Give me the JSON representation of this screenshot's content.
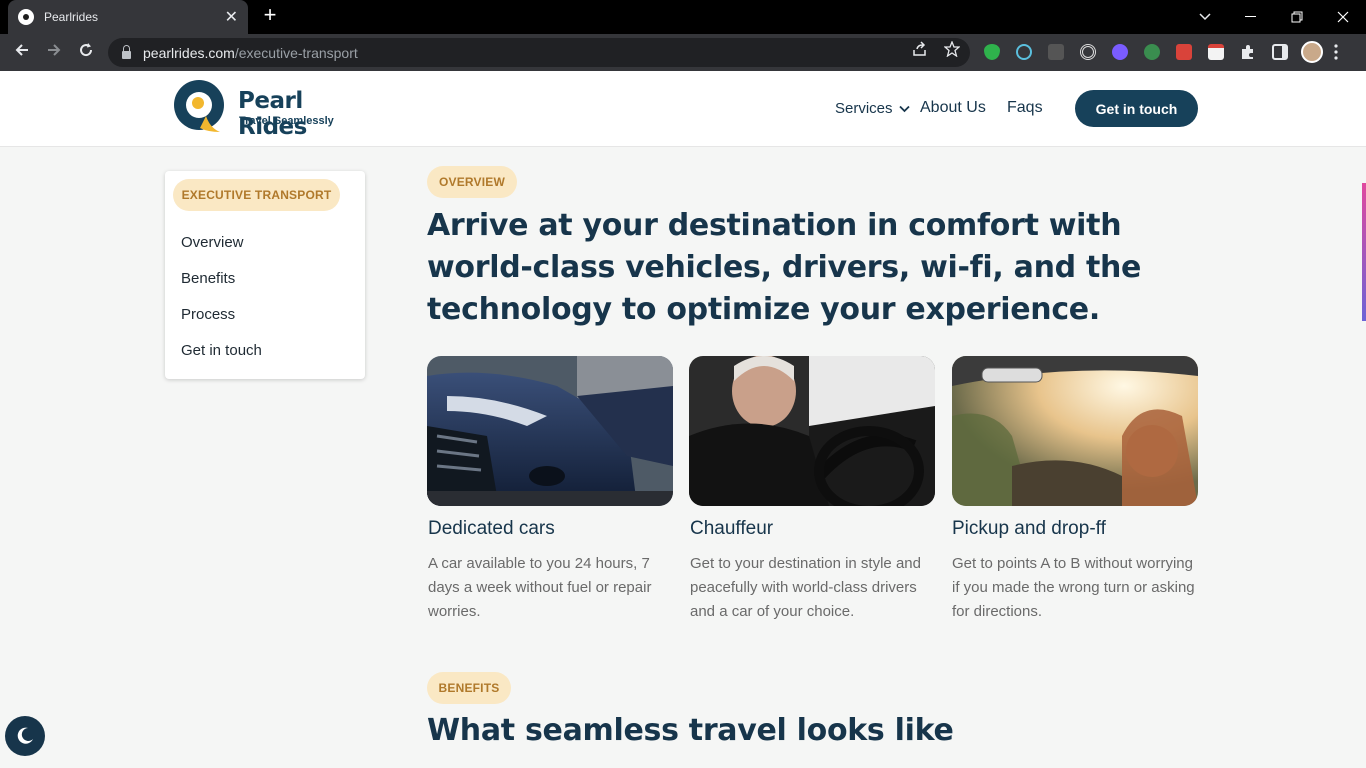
{
  "browser": {
    "tab_title": "Pearlrides",
    "url_host": "pearlrides.com",
    "url_path": "/executive-transport",
    "new_tab": "+",
    "tab_close": "✕"
  },
  "header": {
    "logo_name": "Pearl Rides",
    "logo_tagline": "Travel Seamlessly",
    "nav": {
      "services": "Services",
      "about": "About Us",
      "faqs": "Faqs"
    },
    "cta": "Get in touch"
  },
  "sidebar": {
    "badge": "EXECUTIVE TRANSPORT",
    "items": [
      {
        "label": "Overview"
      },
      {
        "label": "Benefits"
      },
      {
        "label": "Process"
      },
      {
        "label": "Get in touch"
      }
    ]
  },
  "overview": {
    "badge": "OVERVIEW",
    "heading": "Arrive at your destination in comfort with world-class vehicles, drivers, wi-fi, and the technology to optimize your experience.",
    "cards": [
      {
        "title": "Dedicated cars",
        "desc": "A car available to you 24 hours, 7 days a week without fuel or repair worries."
      },
      {
        "title": "Chauffeur",
        "desc": "Get to your destination in style and peacefully with world-class drivers and a car of your choice."
      },
      {
        "title": "Pickup and drop-ff",
        "desc": "Get to points A to B without worrying if you made the wrong turn or asking for directions."
      }
    ]
  },
  "benefits": {
    "badge": "BENEFITS",
    "heading": "What seamless travel looks like"
  },
  "colors": {
    "primary": "#17415a",
    "heading": "#17354b",
    "badge_bg": "#fae8c4",
    "badge_text": "#b0792b",
    "logo_accent": "#f2b72e"
  }
}
